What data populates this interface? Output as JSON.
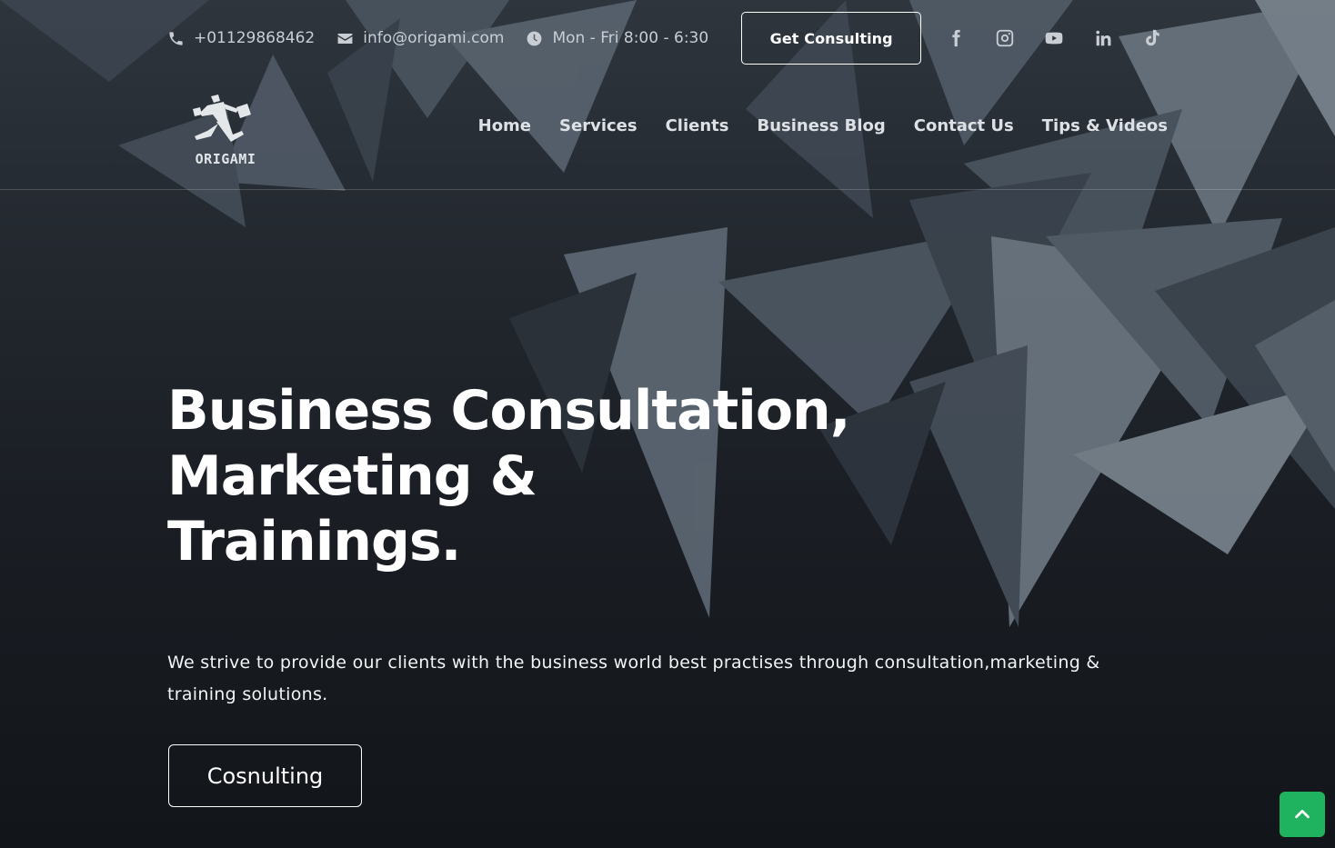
{
  "topbar": {
    "phone": "+01129868462",
    "email": "info@origami.com",
    "hours": "Mon - Fri 8:00 - 6:30",
    "consult_label": "Get Consulting",
    "socials": [
      "facebook-icon",
      "instagram-icon",
      "youtube-icon",
      "linkedin-icon",
      "tiktok-icon"
    ]
  },
  "brand": {
    "name": "ORIGAMI"
  },
  "nav": {
    "items": [
      {
        "label": "Home"
      },
      {
        "label": "Services"
      },
      {
        "label": "Clients"
      },
      {
        "label": "Business Blog"
      },
      {
        "label": "Contact Us"
      },
      {
        "label": "Tips & Videos"
      }
    ]
  },
  "hero": {
    "title_lines": [
      "Business Consultation,",
      "Marketing &",
      "Trainings."
    ],
    "description": "We strive to provide our clients with the business world best practises through consultation,marketing & training solutions.",
    "cta_label": "Cosnulting"
  },
  "colors": {
    "accent": "#1fb35f",
    "text": "#ffffff",
    "muted": "#c9ced4"
  }
}
